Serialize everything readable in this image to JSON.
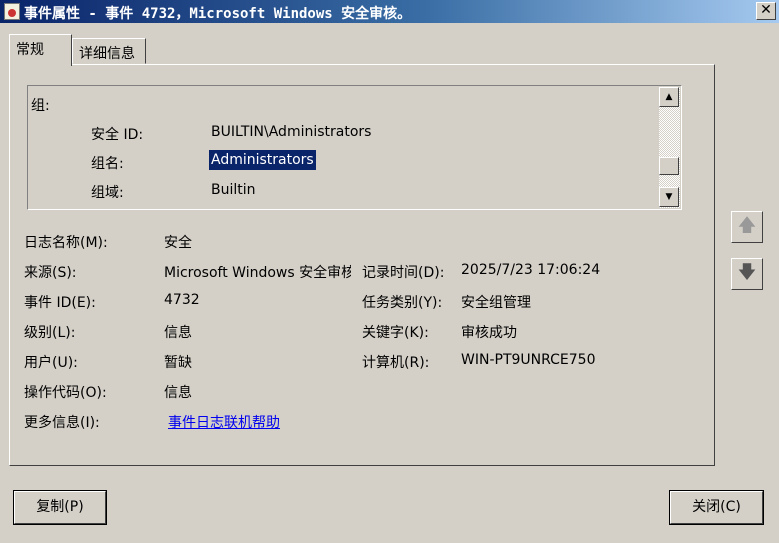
{
  "window": {
    "title": "事件属性 - 事件 4732，Microsoft Windows 安全审核。",
    "close": "✕"
  },
  "tabs": [
    {
      "label": "常规"
    },
    {
      "label": "详细信息"
    }
  ],
  "details": {
    "group_header": "组:",
    "rows": [
      {
        "label": "安全 ID:",
        "value": "BUILTIN\\Administrators"
      },
      {
        "label": "组名:",
        "value": "Administrators"
      },
      {
        "label": "组域:",
        "value": "Builtin"
      }
    ]
  },
  "fields": {
    "log_name": {
      "label": "日志名称(M):",
      "value": "安全"
    },
    "source": {
      "label": "来源(S):",
      "value": "Microsoft Windows 安全审核"
    },
    "logged": {
      "label": "记录时间(D):",
      "value": "2025/7/23 17:06:24"
    },
    "event_id": {
      "label": "事件 ID(E):",
      "value": "4732"
    },
    "task_category": {
      "label": "任务类别(Y):",
      "value": "安全组管理"
    },
    "level": {
      "label": "级别(L):",
      "value": "信息"
    },
    "keywords": {
      "label": "关键字(K):",
      "value": "审核成功"
    },
    "user": {
      "label": "用户(U):",
      "value": "暂缺"
    },
    "computer": {
      "label": "计算机(R):",
      "value": "WIN-PT9UNRCE750"
    },
    "opcode": {
      "label": "操作代码(O):",
      "value": "信息"
    },
    "more_info": {
      "label": "更多信息(I):",
      "value": "事件日志联机帮助"
    }
  },
  "buttons": {
    "copy": "复制(P)",
    "close": "关闭(C)"
  },
  "icons": {
    "up": "🡅",
    "down": "🡇",
    "scroll_up": "▲",
    "scroll_down": "▼"
  }
}
